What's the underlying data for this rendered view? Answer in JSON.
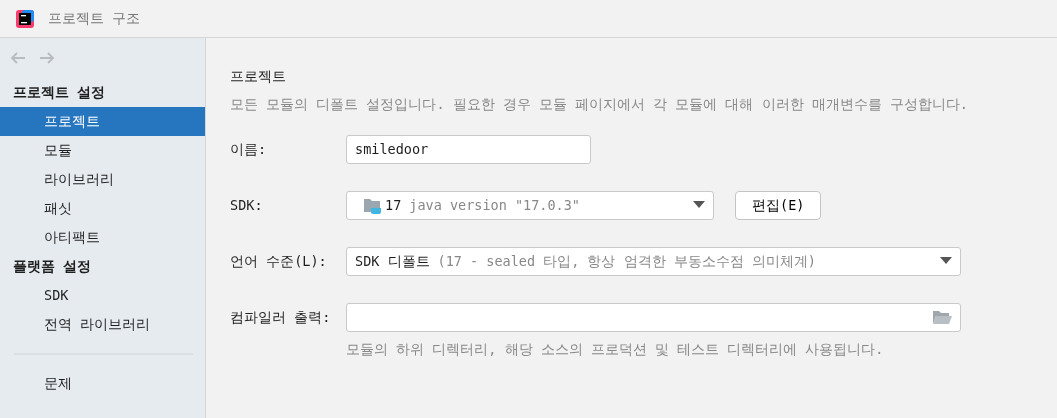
{
  "window": {
    "title": "프로젝트 구조"
  },
  "nav": [
    {
      "kind": "back",
      "disabled": true
    },
    {
      "kind": "forward",
      "disabled": true
    }
  ],
  "sidebar": {
    "sections": [
      {
        "heading": "프로젝트 설정",
        "items": [
          {
            "label": "프로젝트",
            "selected": true
          },
          {
            "label": "모듈",
            "selected": false
          },
          {
            "label": "라이브러리",
            "selected": false
          },
          {
            "label": "패싯",
            "selected": false
          },
          {
            "label": "아티팩트",
            "selected": false
          }
        ]
      },
      {
        "heading": "플랫폼 설정",
        "items": [
          {
            "label": "SDK",
            "selected": false
          },
          {
            "label": "전역 라이브러리",
            "selected": false
          }
        ]
      }
    ],
    "bottom_items": [
      {
        "label": "문제",
        "selected": false
      }
    ]
  },
  "main": {
    "heading": "프로젝트",
    "description": "모든 모듈의 디폴트 설정입니다. 필요한 경우 모듈 페이지에서 각 모듈에 대해 이러한 매개변수를 구성합니다.",
    "fields": [
      {
        "kind": "text",
        "label": "이름:",
        "value": "smiledoor"
      },
      {
        "kind": "sdk",
        "label": "SDK:",
        "value": "17",
        "detail": "java version \"17.0.3\"",
        "button": "편집(E)"
      },
      {
        "kind": "combo",
        "label": "언어 수준(L):",
        "value": "SDK 디폴트",
        "detail": "(17 - sealed 타입, 항상 엄격한 부동소수점 의미체계)"
      },
      {
        "kind": "path",
        "label": "컴파일러 출력:",
        "hint": "모듈의 하위 디렉터리, 해당 소스의 프로덕션 및 테스트 디렉터리에 사용됩니다."
      }
    ]
  }
}
